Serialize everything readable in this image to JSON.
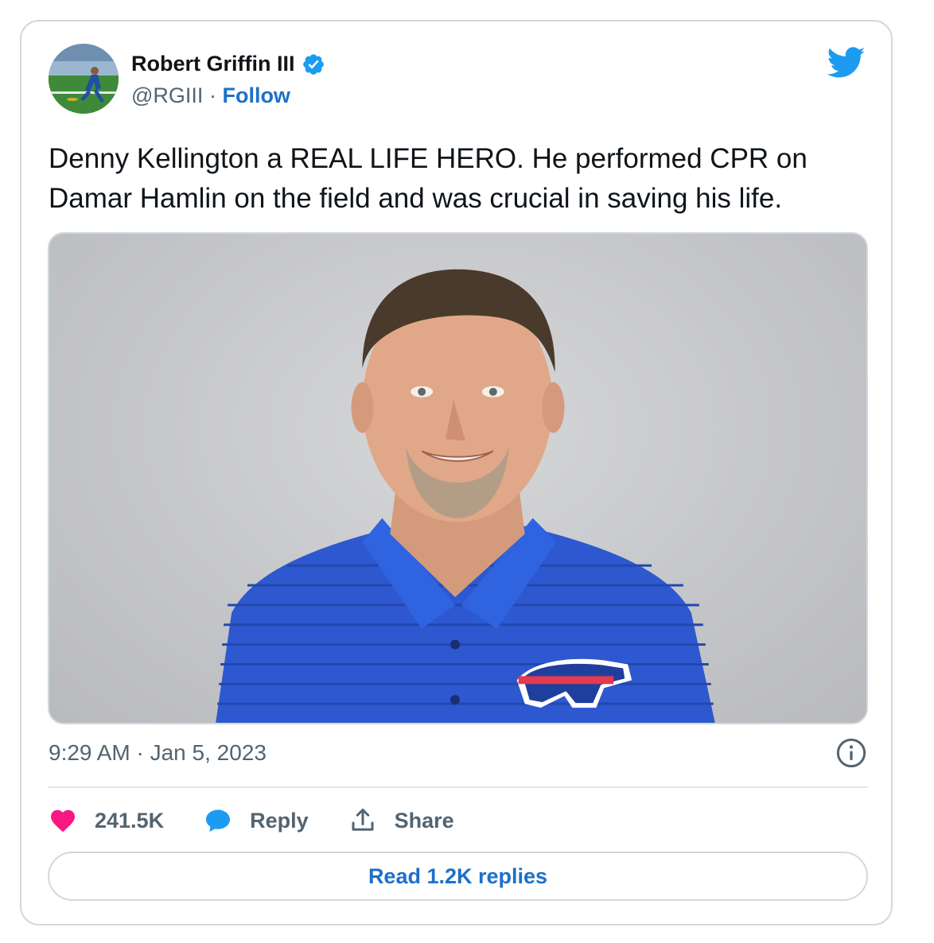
{
  "author": {
    "name": "Robert Griffin III",
    "handle": "@RGIII",
    "separator": "·",
    "follow_label": "Follow",
    "verified": true,
    "avatar_icon": "avatar-football-player-photo"
  },
  "tweet": {
    "text": "Denny Kellington a REAL LIFE HERO. He performed CPR on Damar Hamlin on the field and was crucial in saving his life.",
    "timestamp": "9:29 AM · Jan 5, 2023"
  },
  "actions": {
    "likes": "241.5K",
    "reply_label": "Reply",
    "share_label": "Share"
  },
  "read_replies_label": "Read 1.2K replies",
  "icons": [
    "twitter-bird-icon",
    "verified-badge-icon",
    "heart-icon",
    "reply-bubble-icon",
    "share-icon",
    "info-icon"
  ],
  "colors": {
    "accent": "#1d9bf0",
    "link": "#1d70c9",
    "heart": "#f91880",
    "muted": "#536471"
  }
}
